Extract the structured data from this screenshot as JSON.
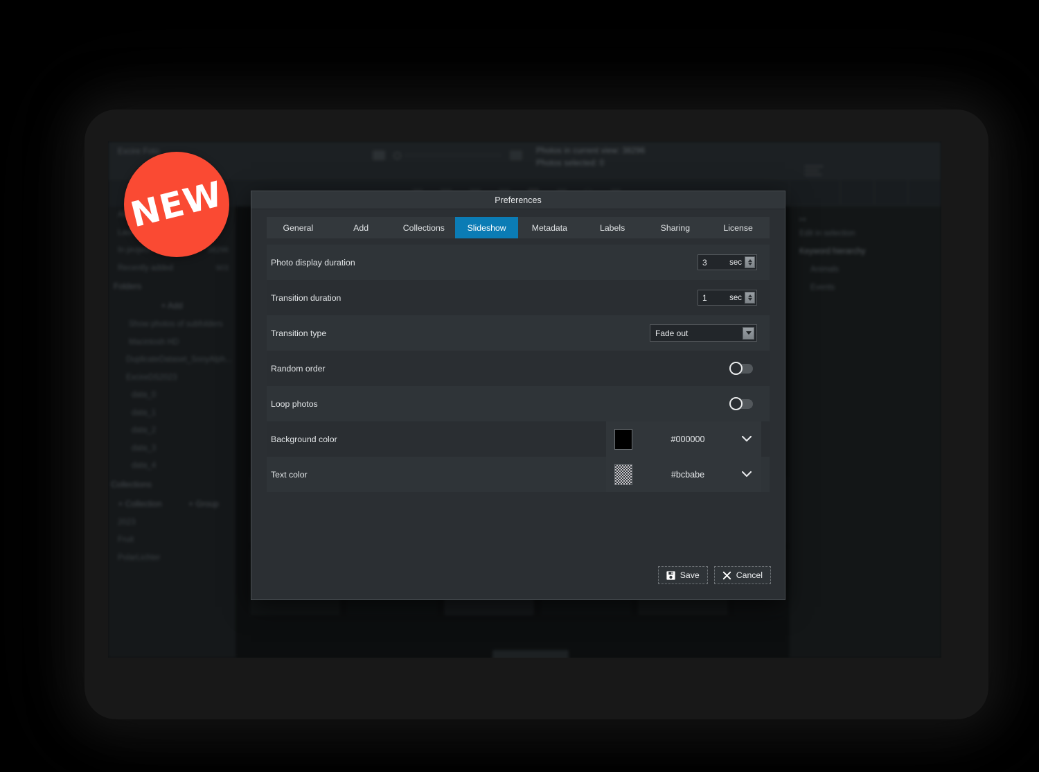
{
  "badge": {
    "label": "NEW"
  },
  "background_app": {
    "status": {
      "photos_in_view": "Photos in current view: 38296",
      "photos_selected": "Photos selected: 0"
    },
    "sidebar": {
      "add_label": "+ Add",
      "subfolders_label": "Show photos of subfolders",
      "drive_label": "Macintosh HD",
      "folders": [
        {
          "label": "DuplicateDataset_SonyAlph...",
          "count": ""
        },
        {
          "label": "ExcireDS2023",
          "count": ""
        },
        {
          "label": "data_0",
          "count": ""
        },
        {
          "label": "data_1",
          "count": ""
        },
        {
          "label": "data_2",
          "count": ""
        },
        {
          "label": "data_3",
          "count": ""
        },
        {
          "label": "data_4",
          "count": ""
        }
      ],
      "smart_rows": [
        {
          "label": "All photos",
          "count": ""
        },
        {
          "label": "Last import",
          "count": ""
        },
        {
          "label": "In project",
          "count": "38296"
        },
        {
          "label": "Recently added",
          "count": "903"
        }
      ],
      "folders_head": "Folders",
      "collections_head": "Collections",
      "collection_btn": "+ Collection",
      "group_btn": "+ Group",
      "collections": [
        {
          "label": "2023"
        },
        {
          "label": "Fruit"
        },
        {
          "label": "PolarLichter"
        }
      ]
    },
    "rightbar": {
      "selection_label": "Edit in selection",
      "keyword_hierarchy": "Keyword hierarchy",
      "keyword_items": [
        "Animals",
        "Events"
      ]
    }
  },
  "dialog": {
    "title": "Preferences",
    "tabs": [
      {
        "label": "General",
        "active": false
      },
      {
        "label": "Add",
        "active": false
      },
      {
        "label": "Collections",
        "active": false
      },
      {
        "label": "Slideshow",
        "active": true
      },
      {
        "label": "Metadata",
        "active": false
      },
      {
        "label": "Labels",
        "active": false
      },
      {
        "label": "Sharing",
        "active": false
      },
      {
        "label": "License",
        "active": false
      }
    ],
    "rows": [
      {
        "label": "Photo display duration",
        "type": "spinner",
        "value": "3",
        "unit": "sec"
      },
      {
        "label": "Transition duration",
        "type": "spinner",
        "value": "1",
        "unit": "sec"
      },
      {
        "label": "Transition type",
        "type": "select",
        "value": "Fade out"
      },
      {
        "label": "Random order",
        "type": "toggle",
        "value": "off"
      },
      {
        "label": "Loop photos",
        "type": "toggle",
        "value": "off"
      },
      {
        "label": "Background color",
        "type": "color",
        "value": "#000000",
        "swatch": "solid"
      },
      {
        "label": "Text color",
        "type": "color",
        "value": "#bcbabe",
        "swatch": "checker"
      }
    ],
    "buttons": {
      "save": "Save",
      "cancel": "Cancel"
    }
  },
  "colors": {
    "accent_blue": "#0b7cb5",
    "badge_red": "#fa4a33",
    "dialog_bg": "#2b2f33",
    "row_odd": "#2f3438",
    "row_even": "#2a2e32"
  }
}
